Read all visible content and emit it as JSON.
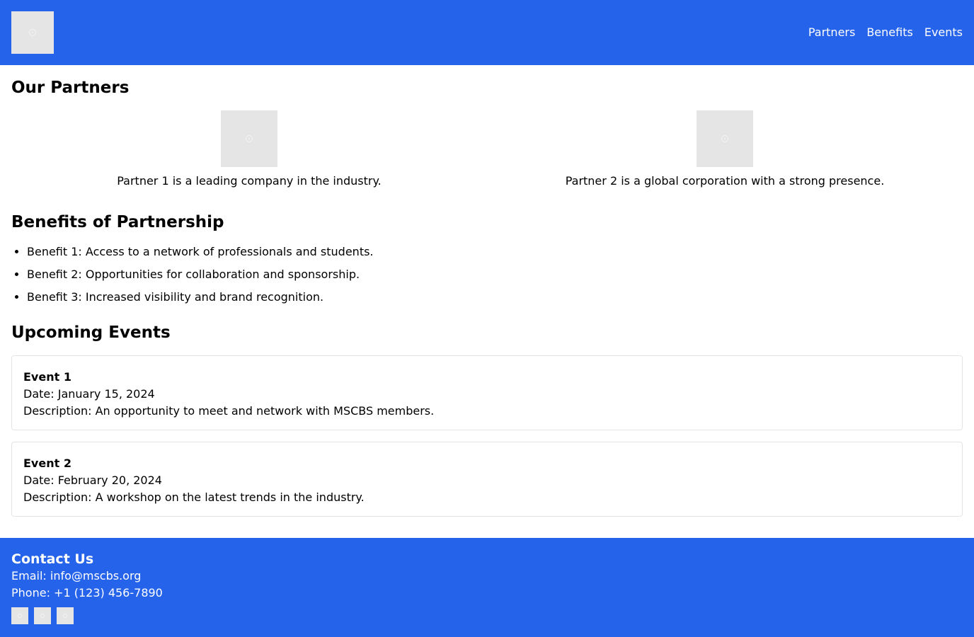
{
  "header": {
    "nav": [
      "Partners",
      "Benefits",
      "Events"
    ]
  },
  "partners": {
    "title": "Our Partners",
    "items": [
      {
        "description": "Partner 1 is a leading company in the industry."
      },
      {
        "description": "Partner 2 is a global corporation with a strong presence."
      }
    ]
  },
  "benefits": {
    "title": "Benefits of Partnership",
    "items": [
      "Benefit 1: Access to a network of professionals and students.",
      "Benefit 2: Opportunities for collaboration and sponsorship.",
      "Benefit 3: Increased visibility and brand recognition."
    ]
  },
  "events": {
    "title": "Upcoming Events",
    "items": [
      {
        "title": "Event 1",
        "date": "Date: January 15, 2024",
        "description": "Description: An opportunity to meet and network with MSCBS members."
      },
      {
        "title": "Event 2",
        "date": "Date: February 20, 2024",
        "description": "Description: A workshop on the latest trends in the industry."
      }
    ]
  },
  "footer": {
    "title": "Contact Us",
    "email": "Email: info@mscbs.org",
    "phone": "Phone: +1 (123) 456-7890",
    "socials": [
      "social-icon",
      "social-icon",
      "social-icon"
    ]
  },
  "colors": {
    "brand": "#2563eb",
    "placeholder": "#e5e5e5",
    "card_border": "#e3e3e3"
  }
}
